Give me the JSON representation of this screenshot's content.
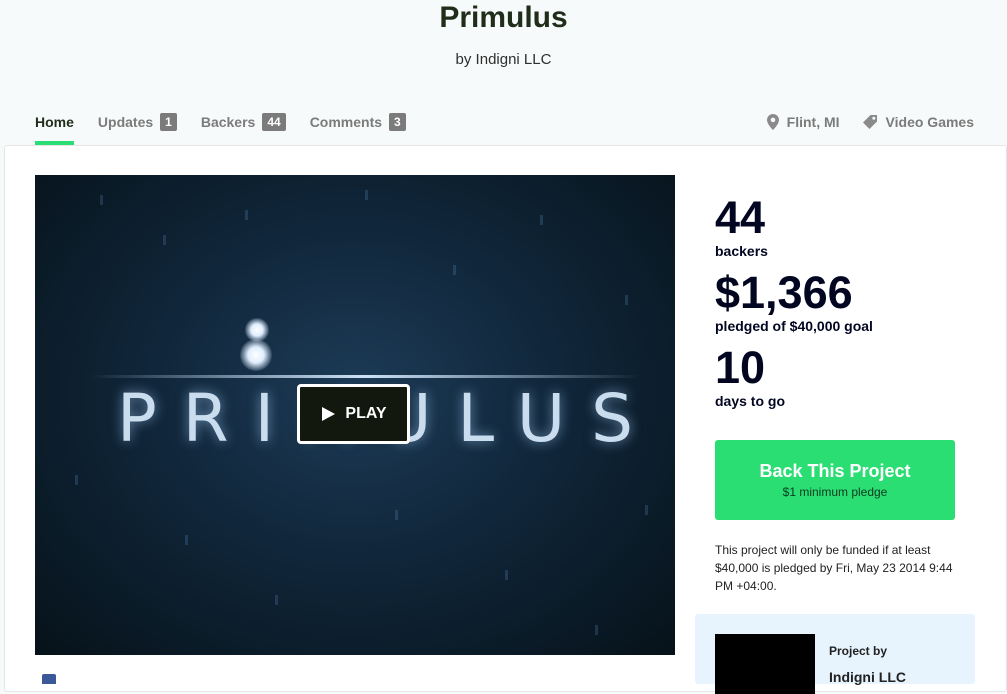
{
  "project": {
    "title": "Primulus",
    "byline": "by Indigni LLC"
  },
  "tabs": [
    {
      "label": "Home",
      "count": null,
      "active": true
    },
    {
      "label": "Updates",
      "count": "1"
    },
    {
      "label": "Backers",
      "count": "44"
    },
    {
      "label": "Comments",
      "count": "3"
    }
  ],
  "meta": {
    "location": "Flint, MI",
    "category": "Video Games"
  },
  "video": {
    "title_art": "PRIMULUS",
    "play_label": "PLAY"
  },
  "stats": {
    "backers_count": "44",
    "backers_label": "backers",
    "pledged": "$1,366",
    "pledged_label": "pledged of $40,000 goal",
    "days": "10",
    "days_label": "days to go"
  },
  "cta": {
    "label": "Back This Project",
    "sub": "$1 minimum pledge"
  },
  "funding_note": "This project will only be funded if at least $40,000 is pledged by Fri, May 23 2014 9:44 PM +04:00.",
  "creator": {
    "heading": "Project by",
    "name": "Indigni LLC"
  },
  "colors": {
    "accent": "#2bde73",
    "badge": "#7b7b7b",
    "creator_bg": "#e7f4fd"
  }
}
